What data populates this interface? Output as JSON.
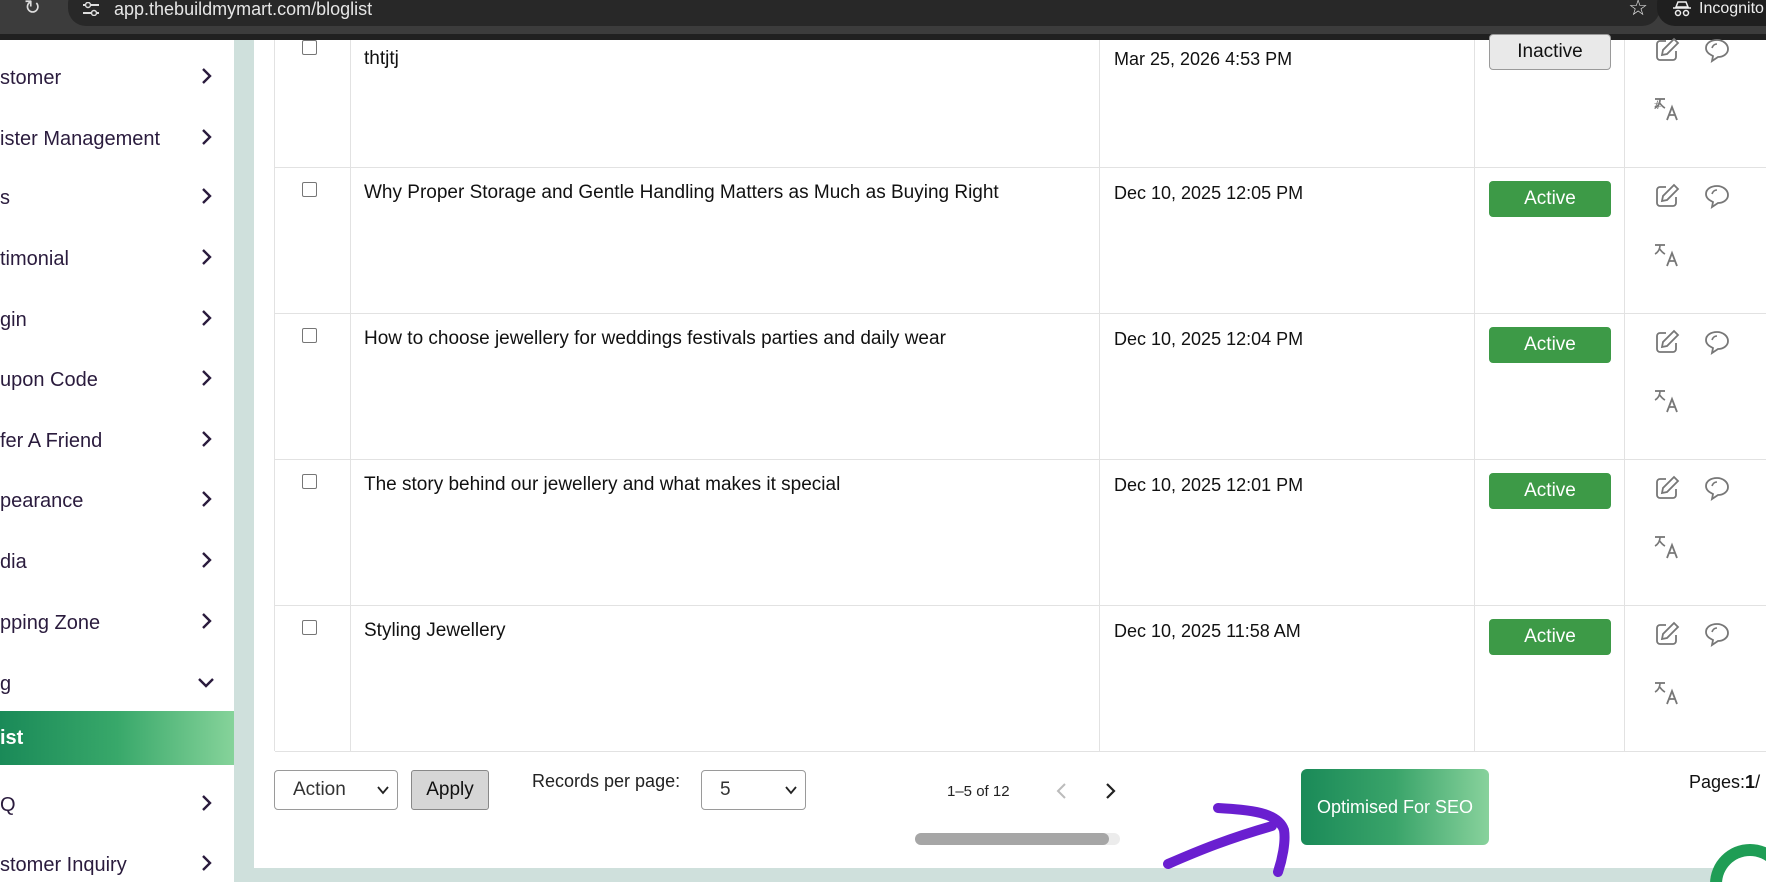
{
  "browser": {
    "url": "app.thebuildmymart.com/bloglist",
    "profile_label": "Incognito"
  },
  "sidebar": {
    "items": [
      {
        "label": "stomer",
        "expanded": false
      },
      {
        "label": "ister Management",
        "expanded": false
      },
      {
        "label": "s",
        "expanded": false
      },
      {
        "label": "timonial",
        "expanded": false
      },
      {
        "label": "gin",
        "expanded": false
      },
      {
        "label": "upon Code",
        "expanded": false
      },
      {
        "label": "fer A Friend",
        "expanded": false
      },
      {
        "label": "pearance",
        "expanded": false
      },
      {
        "label": "dia",
        "expanded": false
      },
      {
        "label": "pping Zone",
        "expanded": false
      },
      {
        "label": "g",
        "expanded": true
      },
      {
        "label": "ist",
        "active": true
      },
      {
        "label": "Q",
        "expanded": false
      },
      {
        "label": "stomer Inquiry",
        "expanded": false
      }
    ]
  },
  "table": {
    "rows": [
      {
        "title": "thtjtj",
        "date": "Mar 25, 2026 4:53 PM",
        "status": "Inactive"
      },
      {
        "title": "Why Proper Storage and Gentle Handling Matters as Much as Buying Right",
        "date": "Dec 10, 2025 12:05 PM",
        "status": "Active"
      },
      {
        "title": "How to choose jewellery for weddings festivals parties and daily wear",
        "date": "Dec 10, 2025 12:04 PM",
        "status": "Active"
      },
      {
        "title": "The story behind our jewellery and what makes it special",
        "date": "Dec 10, 2025 12:01 PM",
        "status": "Active"
      },
      {
        "title": "Styling Jewellery",
        "date": "Dec 10, 2025 11:58 AM",
        "status": "Active"
      }
    ]
  },
  "footer": {
    "action_value": "Action",
    "apply_label": "Apply",
    "records_label": "Records per page:",
    "records_value": "5",
    "range_text": "1–5 of 12",
    "seo_label": "Optimised For SEO",
    "pages_label": "Pages:",
    "pages_current": "1",
    "pages_sep": "/"
  },
  "colors": {
    "accent_green": "#1a8a58",
    "active_badge": "#3d9a47",
    "annotation_arrow": "#6a1fd0"
  }
}
